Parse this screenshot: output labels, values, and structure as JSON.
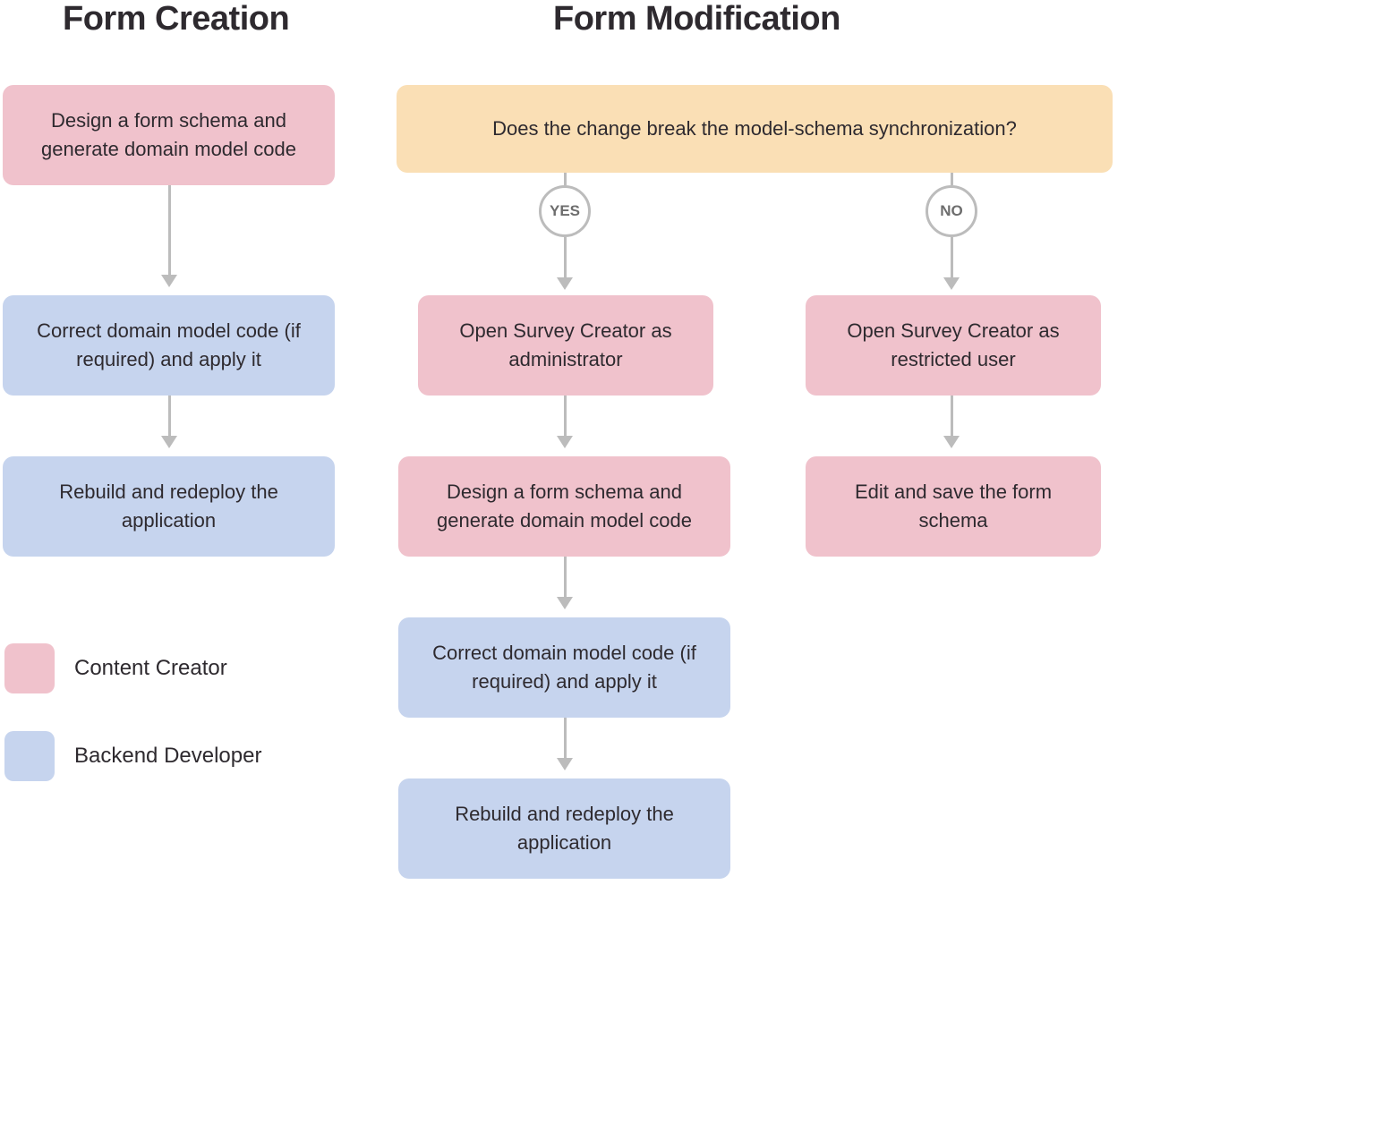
{
  "headings": {
    "formCreation": "Form Creation",
    "formModification": "Form Modification"
  },
  "formCreation": {
    "step1": "Design a form schema and generate domain model code",
    "step2": "Correct domain model code (if required) and apply it",
    "step3": "Rebuild and redeploy the application"
  },
  "formModification": {
    "question": "Does the change break the model-schema synchronization?",
    "yesLabel": "YES",
    "noLabel": "NO",
    "yesPath": {
      "step1": "Open Survey Creator as administrator",
      "step2": "Design a form schema and generate domain model code",
      "step3": "Correct domain model code (if required) and apply it",
      "step4": "Rebuild and redeploy the application"
    },
    "noPath": {
      "step1": "Open Survey Creator as restricted user",
      "step2": "Edit and save the form schema"
    }
  },
  "legend": {
    "pink": "Content Creator",
    "blue": "Backend Developer"
  },
  "colors": {
    "pink": "#f0c2cc",
    "blue": "#c6d4ee",
    "orange": "#fadfb5",
    "arrow": "#bcbcbc"
  }
}
